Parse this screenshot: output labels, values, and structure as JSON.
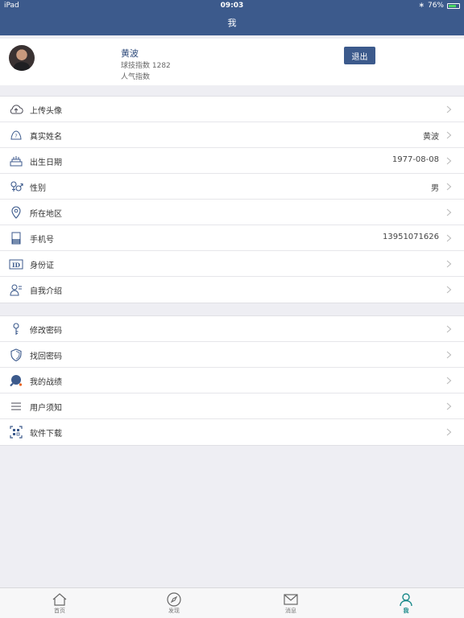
{
  "status": {
    "device": "iPad",
    "time": "09:03",
    "battery": "76%",
    "battery_level": 0.76
  },
  "nav": {
    "title": "我"
  },
  "profile": {
    "name": "黄波",
    "skill": "球技指数 1282",
    "popularity": "人气指数",
    "logout_label": "退出"
  },
  "group1": [
    {
      "label": "上传头像",
      "value": "",
      "icon": "upload-cloud-icon"
    },
    {
      "label": "真实姓名",
      "value": "黄波",
      "icon": "name-card-icon"
    },
    {
      "label": "出生日期",
      "value": "1977-08-08",
      "icon": "birthday-cake-icon"
    },
    {
      "label": "性别",
      "value": "男",
      "icon": "gender-icon"
    },
    {
      "label": "所在地区",
      "value": "",
      "icon": "location-pin-icon"
    },
    {
      "label": "手机号",
      "value": "13951071626",
      "icon": "phone-icon"
    },
    {
      "label": "身份证",
      "value": "",
      "icon": "id-card-icon"
    },
    {
      "label": "自我介绍",
      "value": "",
      "icon": "person-intro-icon"
    }
  ],
  "group2": [
    {
      "label": "修改密码",
      "value": "",
      "icon": "key-icon"
    },
    {
      "label": "找回密码",
      "value": "",
      "icon": "shield-icon"
    },
    {
      "label": "我的战绩",
      "value": "",
      "icon": "ping-pong-icon"
    },
    {
      "label": "用户须知",
      "value": "",
      "icon": "list-icon"
    },
    {
      "label": "软件下载",
      "value": "",
      "icon": "qr-scan-icon"
    }
  ],
  "tabs": [
    {
      "label": "首页",
      "icon": "home-icon",
      "active": false
    },
    {
      "label": "发现",
      "icon": "compass-icon",
      "active": false
    },
    {
      "label": "消息",
      "icon": "mail-icon",
      "active": false
    },
    {
      "label": "我",
      "icon": "person-icon",
      "active": true
    }
  ],
  "colors": {
    "brand": "#3c5a8c",
    "active_tab": "#1a8a8a",
    "background": "#eeeef3"
  }
}
